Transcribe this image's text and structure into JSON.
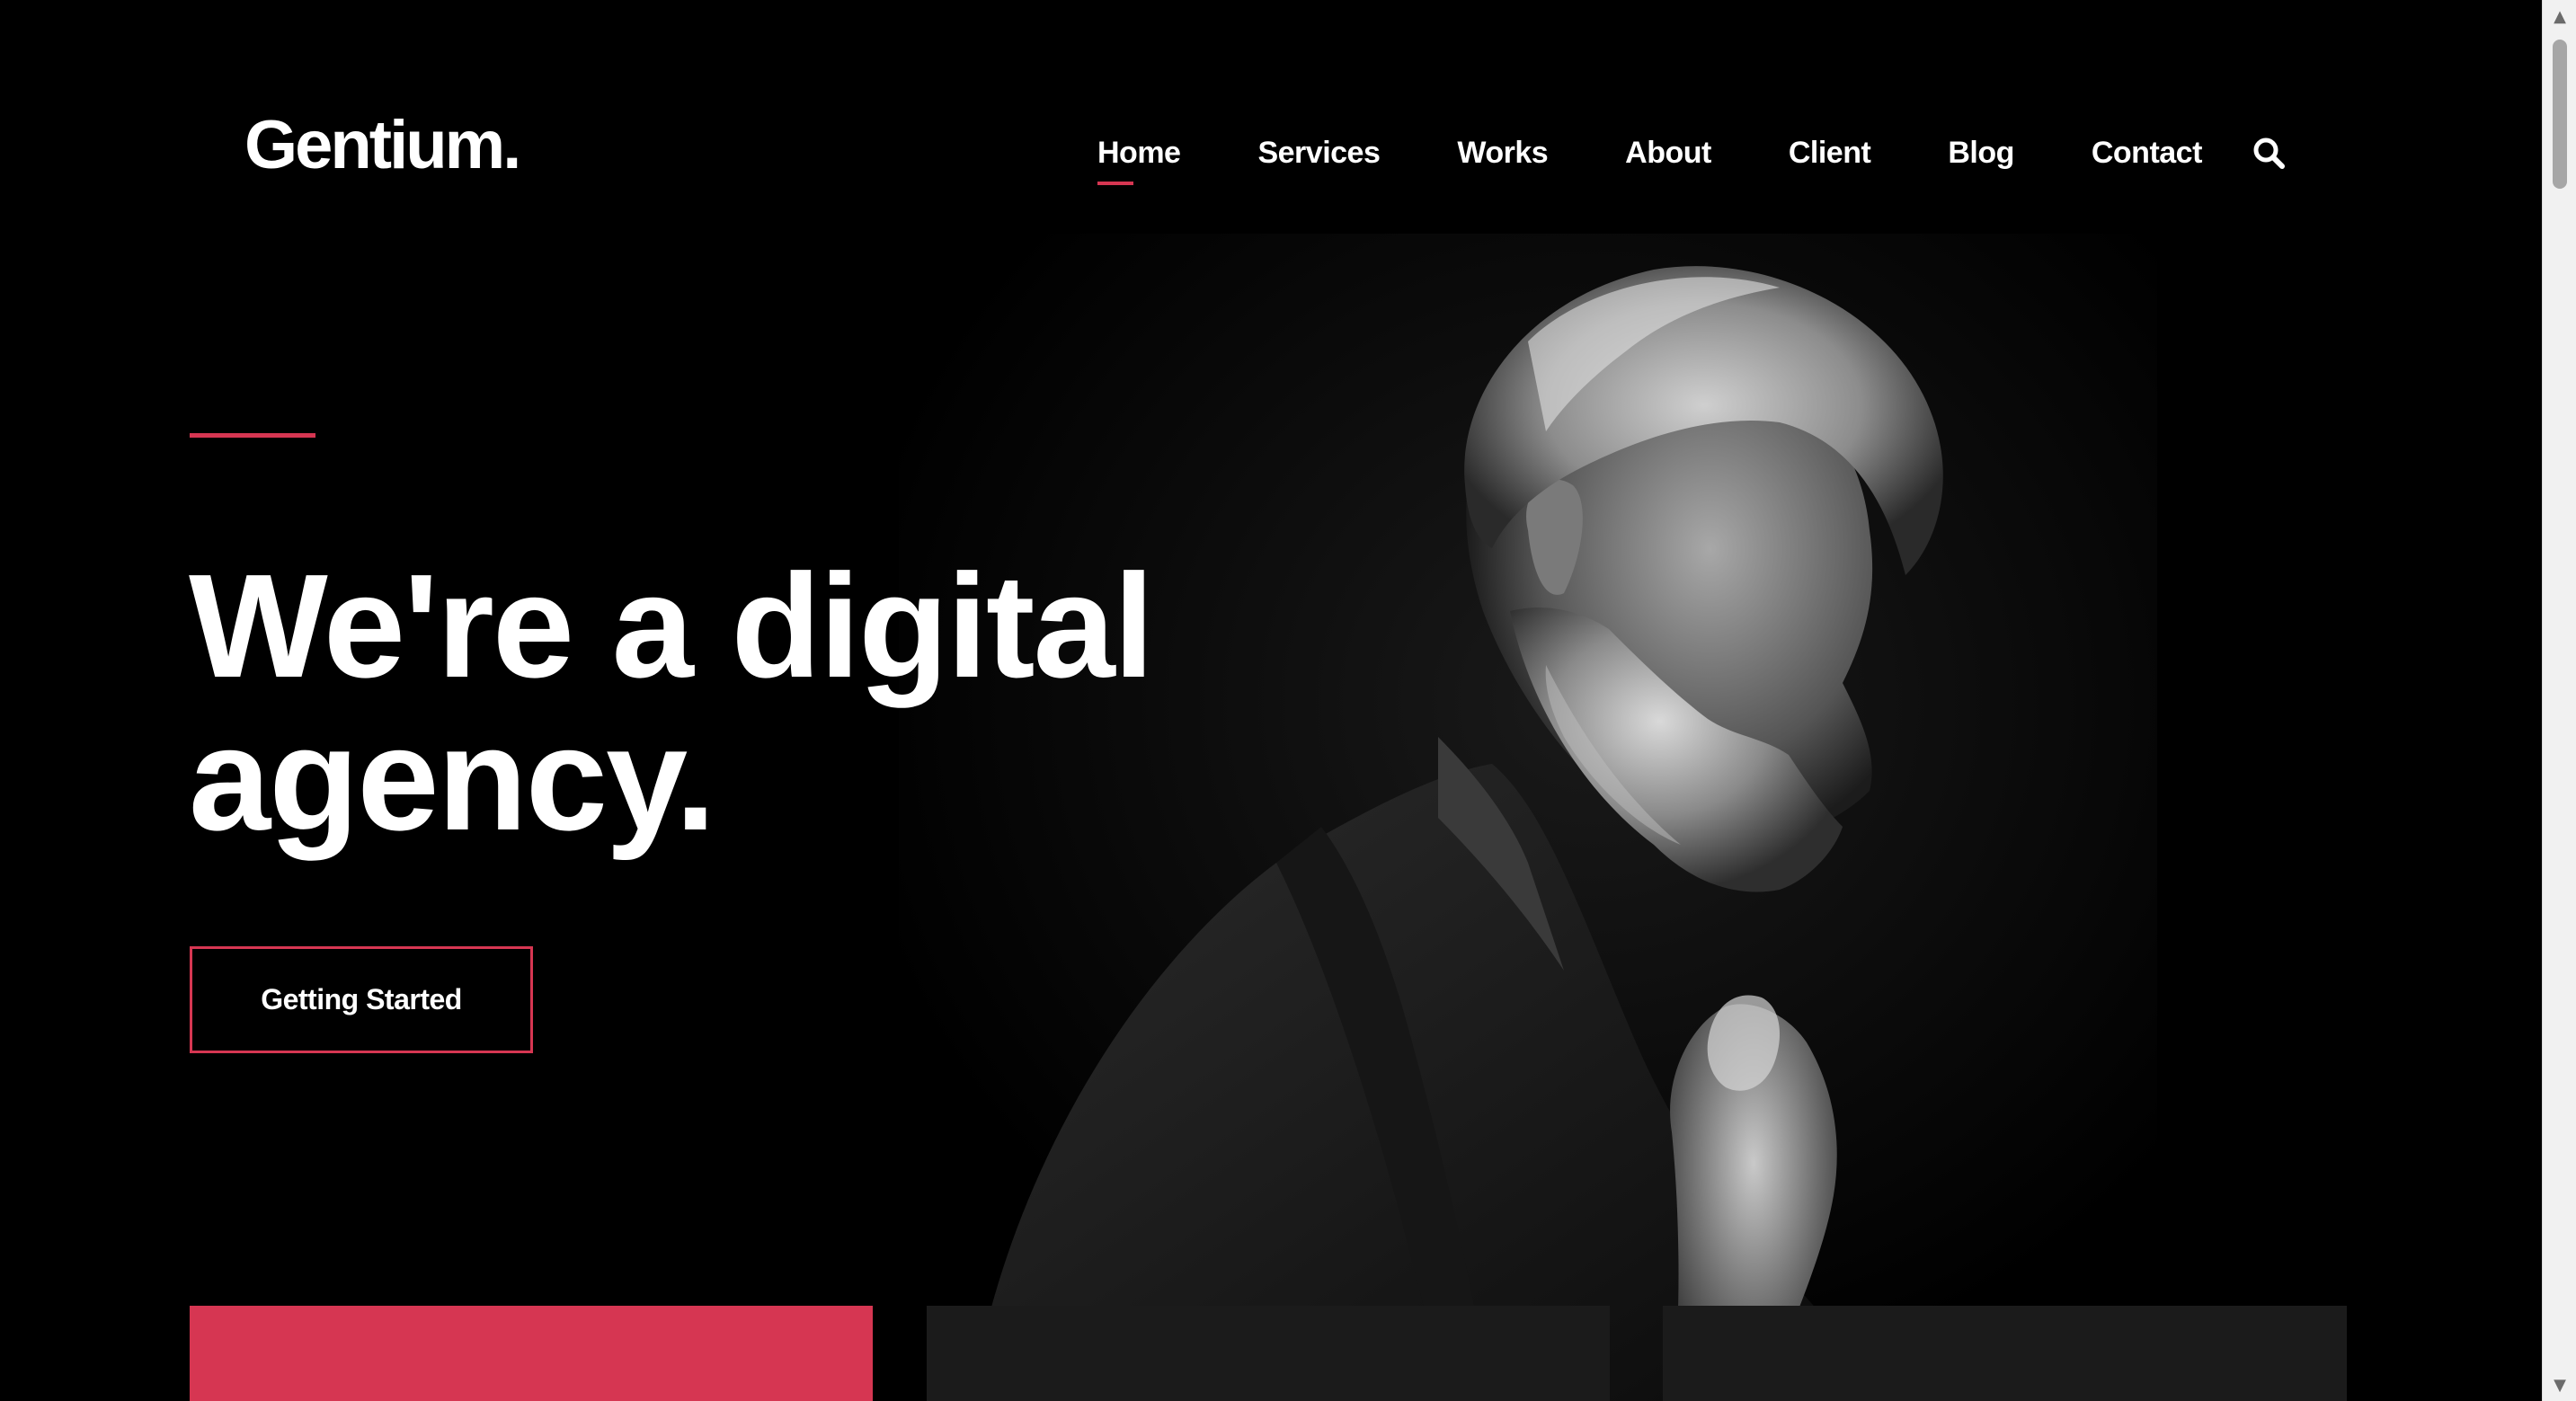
{
  "brand": {
    "logo": "Gentium."
  },
  "nav": {
    "items": [
      "Home",
      "Services",
      "Works",
      "About",
      "Client",
      "Blog",
      "Contact"
    ],
    "active": "Home",
    "search_icon": "search-icon"
  },
  "hero": {
    "headline_line1": "We're a digital",
    "headline_line2": "agency.",
    "cta_label": "Getting Started",
    "image_icon": "bearded-man-portrait"
  },
  "colors": {
    "background": "#000000",
    "accent": "#d63652",
    "card_dark": "#1b1b1b",
    "text": "#ffffff"
  },
  "scrollbar": {
    "up_icon": "arrow-up-icon",
    "down_icon": "arrow-down-icon"
  }
}
